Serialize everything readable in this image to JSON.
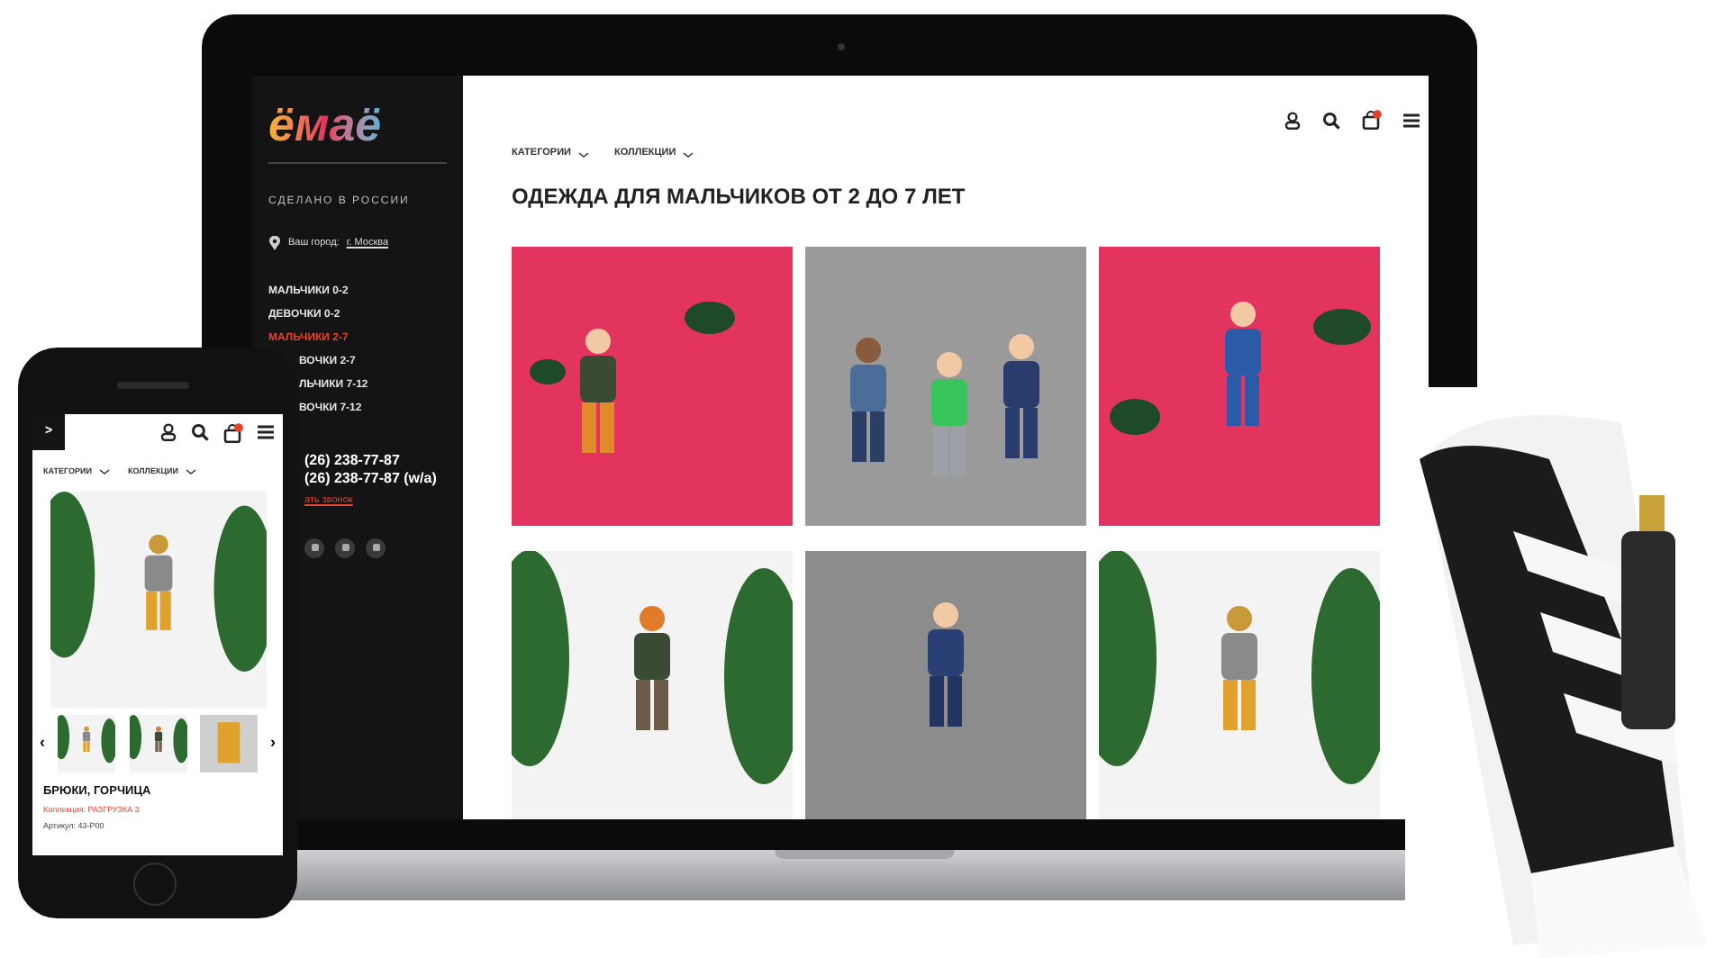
{
  "laptop": {
    "sidebar": {
      "logo": "ёмаё",
      "tagline": "СДЕЛАНО В РОССИИ",
      "city_label": "Ваш город:",
      "city": "г. Москва",
      "menu": [
        {
          "label": "МАЛЬЧИКИ 0-2",
          "selected": false
        },
        {
          "label": "ДЕВОЧКИ 0-2",
          "selected": false
        },
        {
          "label": "МАЛЬЧИКИ 2-7",
          "selected": true
        },
        {
          "label": "ВОЧКИ 2-7",
          "selected": false
        },
        {
          "label": "ЛЬЧИКИ 7-12",
          "selected": false
        },
        {
          "label": "ВОЧКИ 7-12",
          "selected": false
        }
      ],
      "phones": [
        "(26) 238-77-87",
        "(26) 238-77-87 (w/a)"
      ],
      "callback_link": "ать звонок"
    },
    "filters": [
      {
        "label": "КАТЕГОРИИ"
      },
      {
        "label": "КОЛЛЕКЦИИ"
      }
    ],
    "title": "ОДЕЖДА ДЛЯ МАЛЬЧИКОВ ОТ 2 ДО 7 ЛЕТ"
  },
  "phone": {
    "back_glyph": ">",
    "filters": [
      {
        "label": "КАТЕГОРИИ"
      },
      {
        "label": "КОЛЛЕКЦИИ"
      }
    ],
    "prev_glyph": "‹",
    "next_glyph": "›",
    "product_title": "БРЮКИ, ГОРЧИЦА",
    "collection": "Коллекция: РАЗГРУЗКА 3",
    "article": "Артикул: 43-Р00"
  }
}
